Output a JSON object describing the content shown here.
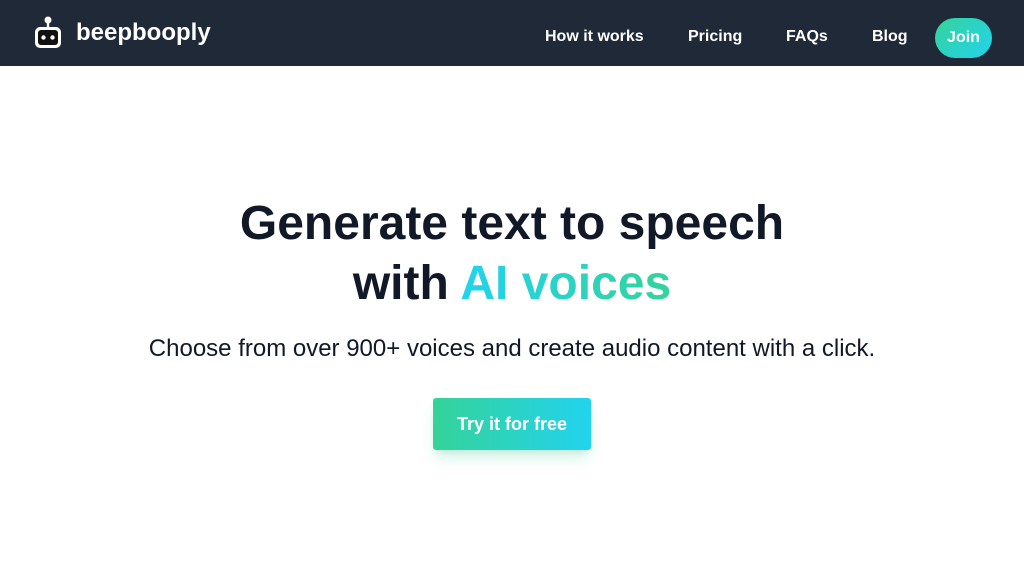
{
  "nav": {
    "brand": {
      "name": "beepbooply",
      "icon": "robot-icon"
    },
    "links": [
      "How it works",
      "Pricing",
      "FAQs",
      "Blog"
    ],
    "join_label": "Join"
  },
  "hero": {
    "title_line1": "Generate text to speech",
    "title_line2_prefix": "with ",
    "title_line2_accent": "AI voices",
    "subtitle": "Choose from over 900+ voices and create audio content with a click.",
    "cta_label": "Try it for free"
  },
  "colors": {
    "nav_background": "#1f2937",
    "accent_start": "#34d399",
    "accent_end": "#22d3ee",
    "heading_text": "#111827"
  }
}
